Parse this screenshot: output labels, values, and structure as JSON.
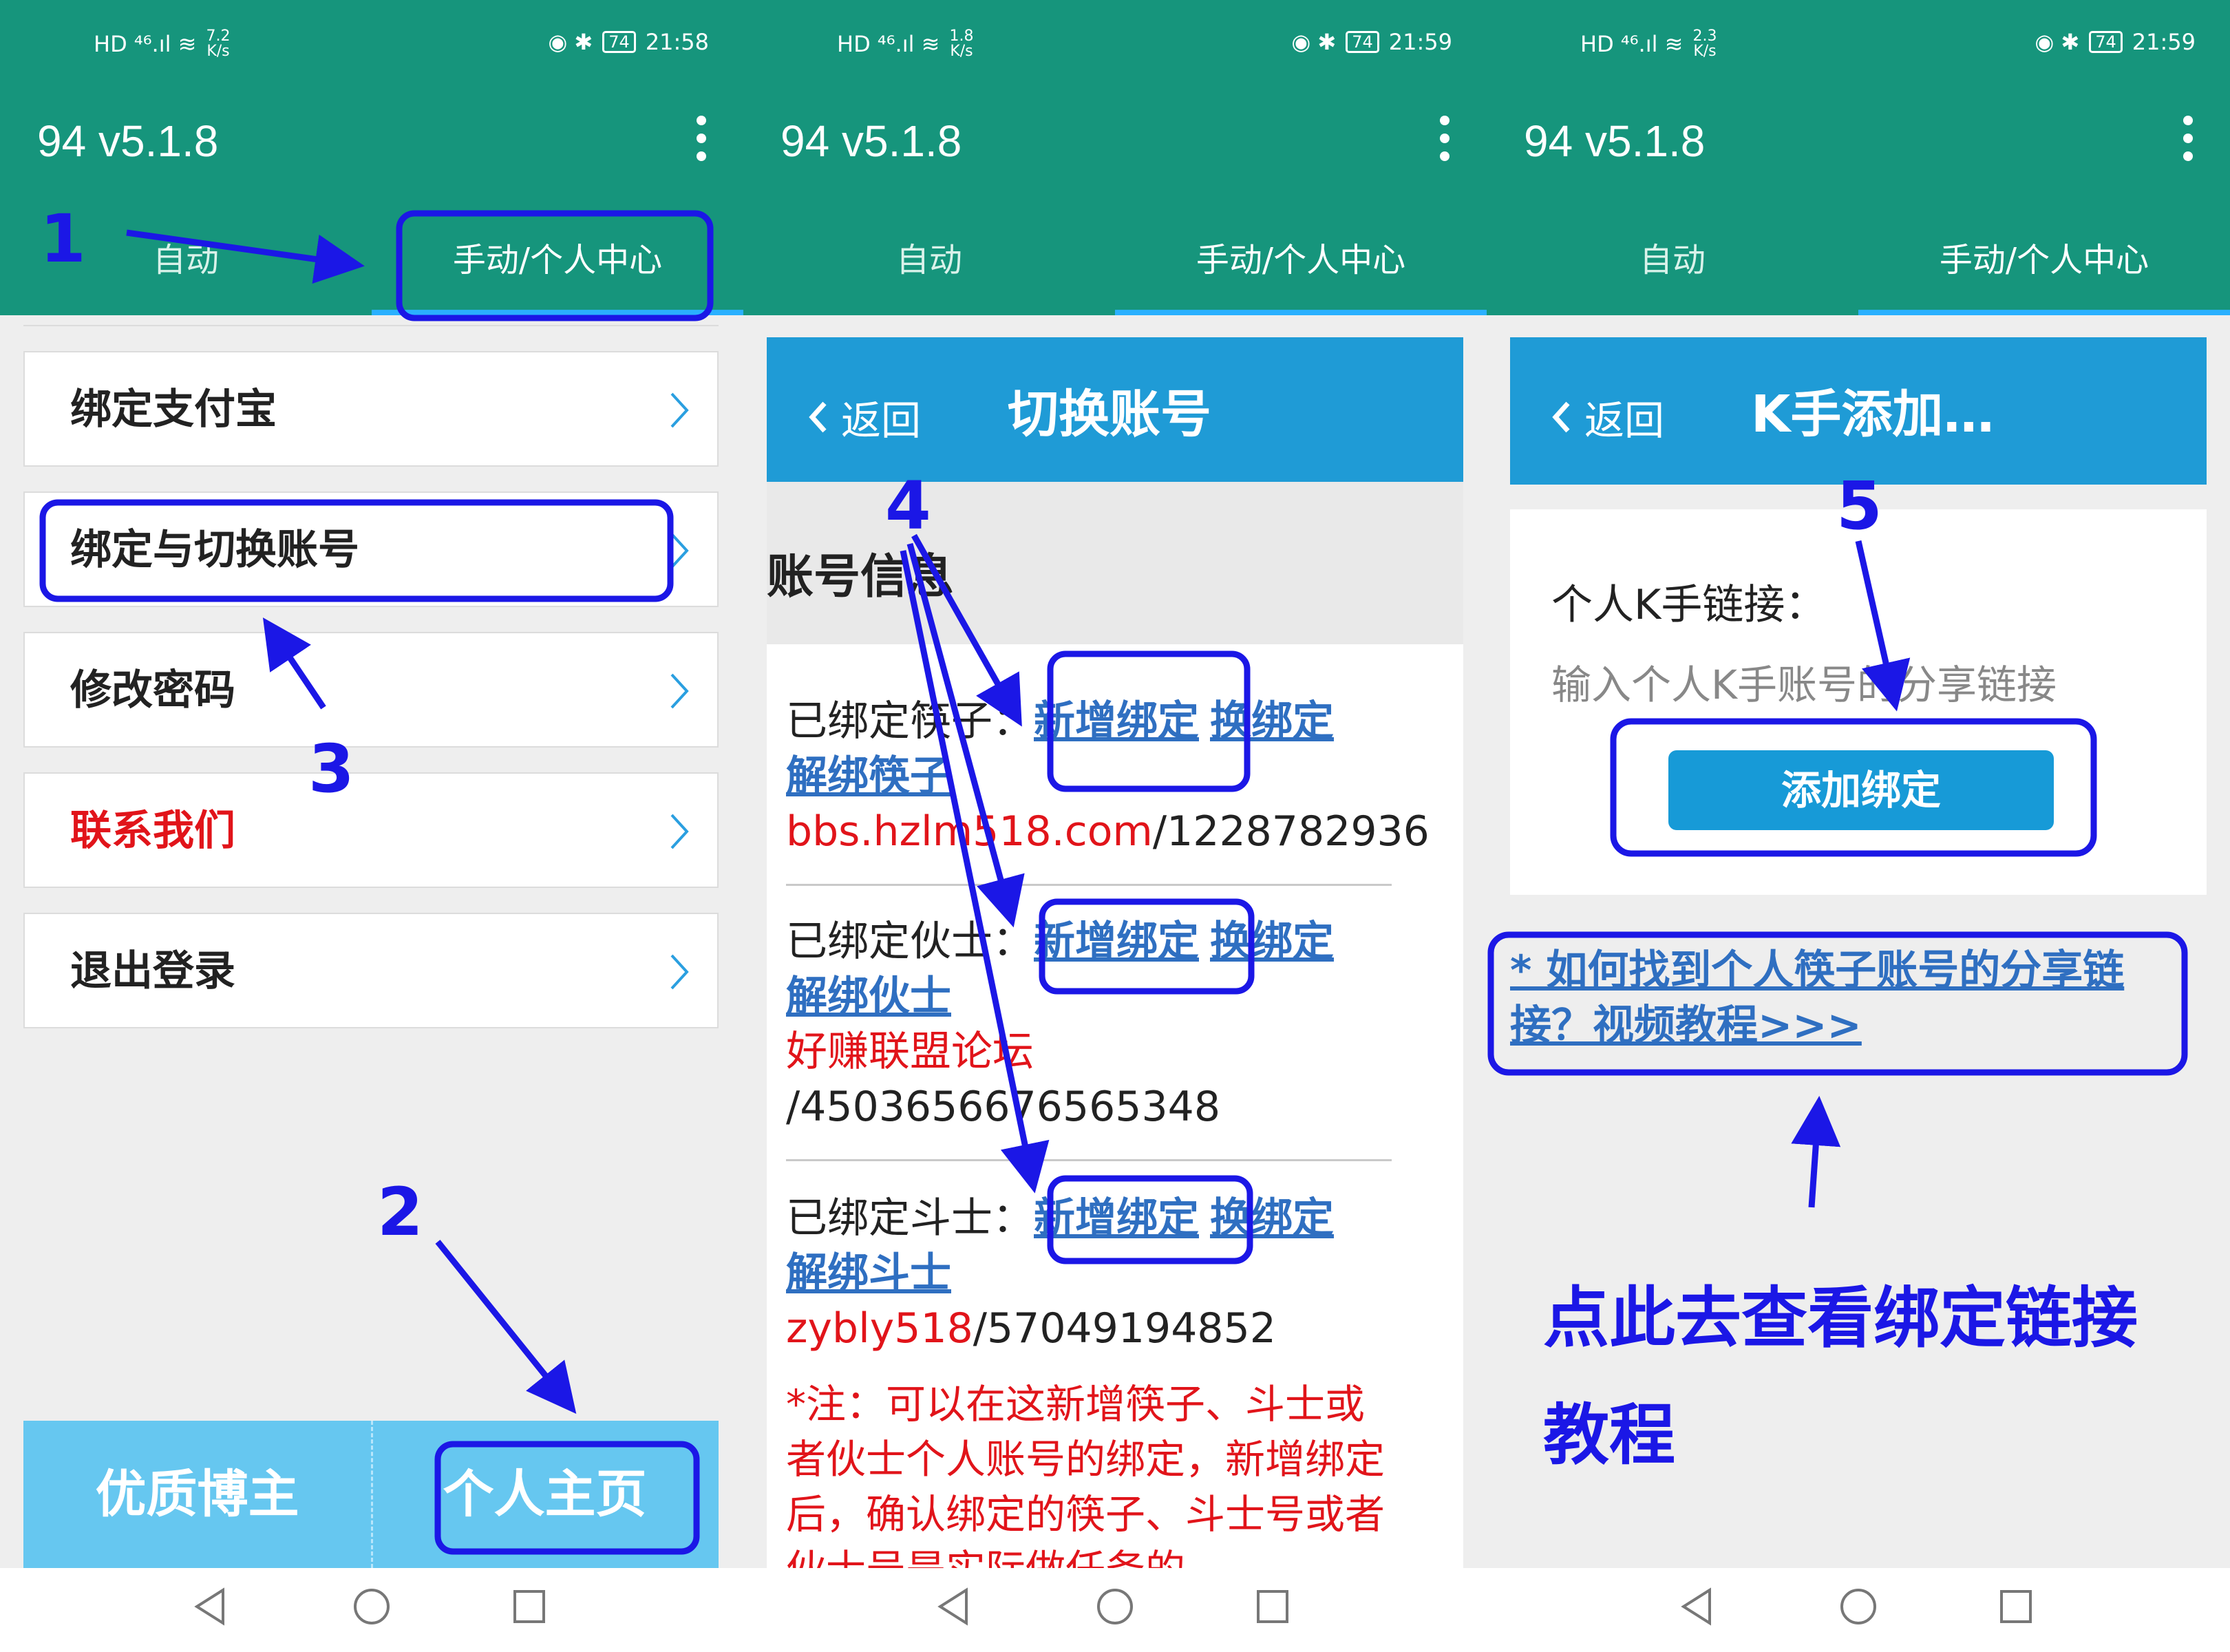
{
  "phones": [
    {
      "status": {
        "left_icons": "HD ⁴⁶.ıl ≋",
        "speed": "7.2\nK/s",
        "right_icons": "◉ ✱",
        "battery": "74",
        "time": "21:58"
      },
      "app": {
        "title": "94 v5.1.8",
        "tab_auto": "自动",
        "tab_manual": "手动/个人中心"
      }
    },
    {
      "status": {
        "left_icons": "HD ⁴⁶.ıl ≋",
        "speed": "1.8\nK/s",
        "right_icons": "◉ ✱",
        "battery": "74",
        "time": "21:59"
      },
      "app": {
        "title": "94 v5.1.8",
        "tab_auto": "自动",
        "tab_manual": "手动/个人中心"
      }
    },
    {
      "status": {
        "left_icons": "HD ⁴⁶.ıl ≋",
        "speed": "2.3\nK/s",
        "right_icons": "◉ ✱",
        "battery": "74",
        "time": "21:59"
      },
      "app": {
        "title": "94 v5.1.8",
        "tab_auto": "自动",
        "tab_manual": "手动/个人中心"
      }
    }
  ],
  "screen1": {
    "menu": [
      "绑定支付宝",
      "绑定与切换账号",
      "修改密码",
      "联系我们",
      "退出登录"
    ],
    "bottom_left": "优质博主",
    "bottom_right": "个人主页"
  },
  "screen2": {
    "back": "返回",
    "title": "切换账号",
    "section": "账号信息",
    "link_add": "新增绑定",
    "link_change": "换绑定",
    "accounts": [
      {
        "label": "已绑定筷子：",
        "unbind": "解绑筷子",
        "site": "bbs.hzlm518.com",
        "id": "/1228782936"
      },
      {
        "label": "已绑定伙士：",
        "unbind": "解绑伙士",
        "site": "好赚联盟论坛",
        "id": "/4503656676565348"
      },
      {
        "label": "已绑定斗士：",
        "unbind": "解绑斗士",
        "site": "zybly518",
        "id": "/57049194852"
      }
    ],
    "note": "*注：可以在这新增筷子、斗士或者伙士个人账号的绑定，新增绑定后，确认绑定的筷子、斗士号或者伙士号是实际做任务的"
  },
  "screen3": {
    "back": "返回",
    "title": "K手添加…",
    "label": "个人K手链接：",
    "placeholder": "输入个人K手账号的分享链接",
    "button": "添加绑定",
    "help_link": "* 如何找到个人筷子账号的分享链接？视频教程>>>",
    "tutorial_line1": "点此去查看绑定链接",
    "tutorial_line2": "教程"
  },
  "annotations": {
    "n1": "1",
    "n2": "2",
    "n3": "3",
    "n4": "4",
    "n5": "5"
  },
  "colors": {
    "teal": "#16957c",
    "blue_header": "#1f9bd6",
    "annotation": "#1b17e6",
    "link": "#2f6fc1",
    "red": "#e1141a"
  }
}
